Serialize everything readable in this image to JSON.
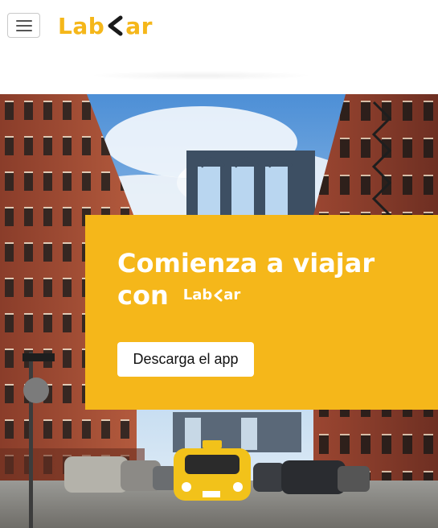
{
  "navbar": {
    "toggle_icon": "hamburger-menu-icon",
    "logo": {
      "left": "Lab",
      "right": "ar",
      "color": "#f5b71a"
    }
  },
  "hero": {
    "title_line1": "Comienza a viajar",
    "title_line2": "con",
    "title_logo_left": "Lab",
    "title_logo_right": "ar",
    "cta_label": "Descarga el app",
    "accent_color": "#f5b71a"
  }
}
